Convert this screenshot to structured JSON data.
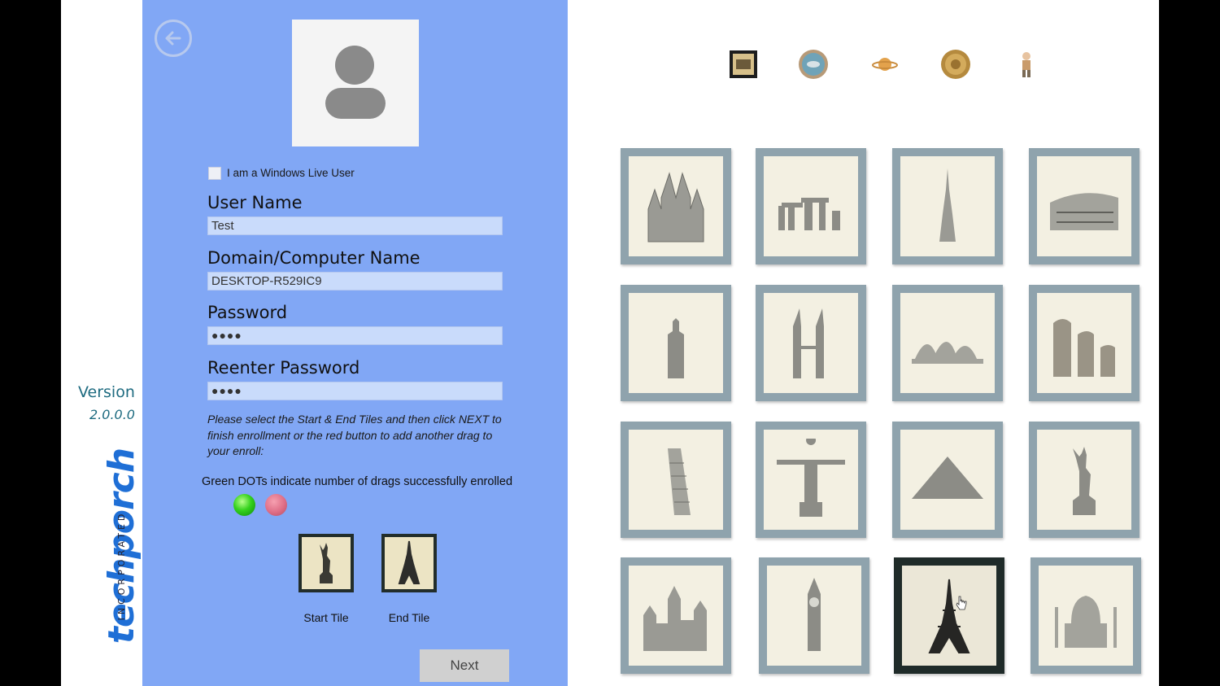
{
  "brand": {
    "version_label": "Version",
    "version_number": "2.0.0.0",
    "logo_main": "techporch",
    "logo_sub": "INCORPORATED",
    "accent_color": "#1f6fd6"
  },
  "form": {
    "windows_live_label": "I am a Windows Live User",
    "windows_live_checked": false,
    "fields": {
      "username": {
        "label": "User Name",
        "value": "Test"
      },
      "domain": {
        "label": "Domain/Computer Name",
        "value": "DESKTOP-R529IC9"
      },
      "password": {
        "label": "Password",
        "value": "●●●●"
      },
      "reenter": {
        "label": "Reenter Password",
        "value": "●●●●"
      }
    },
    "instructions": "Please select the Start & End Tiles and then click NEXT to finish enrollment or the red button to add another drag to your enroll:",
    "dots_caption": "Green DOTs indicate number of drags successfully enrolled",
    "start_tile_label": "Start Tile",
    "end_tile_label": "End Tile",
    "next_label": "Next",
    "panel_color": "#81a7f5"
  },
  "themes": [
    "portrait-icon",
    "fish-icon",
    "planet-icon",
    "coin-icon",
    "cartoon-icon"
  ],
  "tiles": [
    {
      "name": "tile-cathedral",
      "icon": "cathedral-icon"
    },
    {
      "name": "tile-stonehenge",
      "icon": "stonehenge-icon"
    },
    {
      "name": "tile-burj-khalifa",
      "icon": "burj-khalifa-icon"
    },
    {
      "name": "tile-colosseum",
      "icon": "colosseum-icon"
    },
    {
      "name": "tile-empire-state",
      "icon": "empire-state-icon"
    },
    {
      "name": "tile-petronas",
      "icon": "petronas-towers-icon"
    },
    {
      "name": "tile-sydney-opera",
      "icon": "opera-house-icon"
    },
    {
      "name": "tile-moai",
      "icon": "moai-icon"
    },
    {
      "name": "tile-pisa",
      "icon": "leaning-tower-icon"
    },
    {
      "name": "tile-christ-redeemer",
      "icon": "christ-redeemer-icon"
    },
    {
      "name": "tile-pyramid",
      "icon": "pyramid-icon"
    },
    {
      "name": "tile-statue-liberty",
      "icon": "statue-liberty-icon"
    },
    {
      "name": "tile-castle",
      "icon": "castle-icon"
    },
    {
      "name": "tile-big-ben",
      "icon": "big-ben-icon"
    },
    {
      "name": "tile-eiffel",
      "icon": "eiffel-tower-icon",
      "selected": true
    },
    {
      "name": "tile-taj-mahal",
      "icon": "taj-mahal-icon"
    }
  ]
}
